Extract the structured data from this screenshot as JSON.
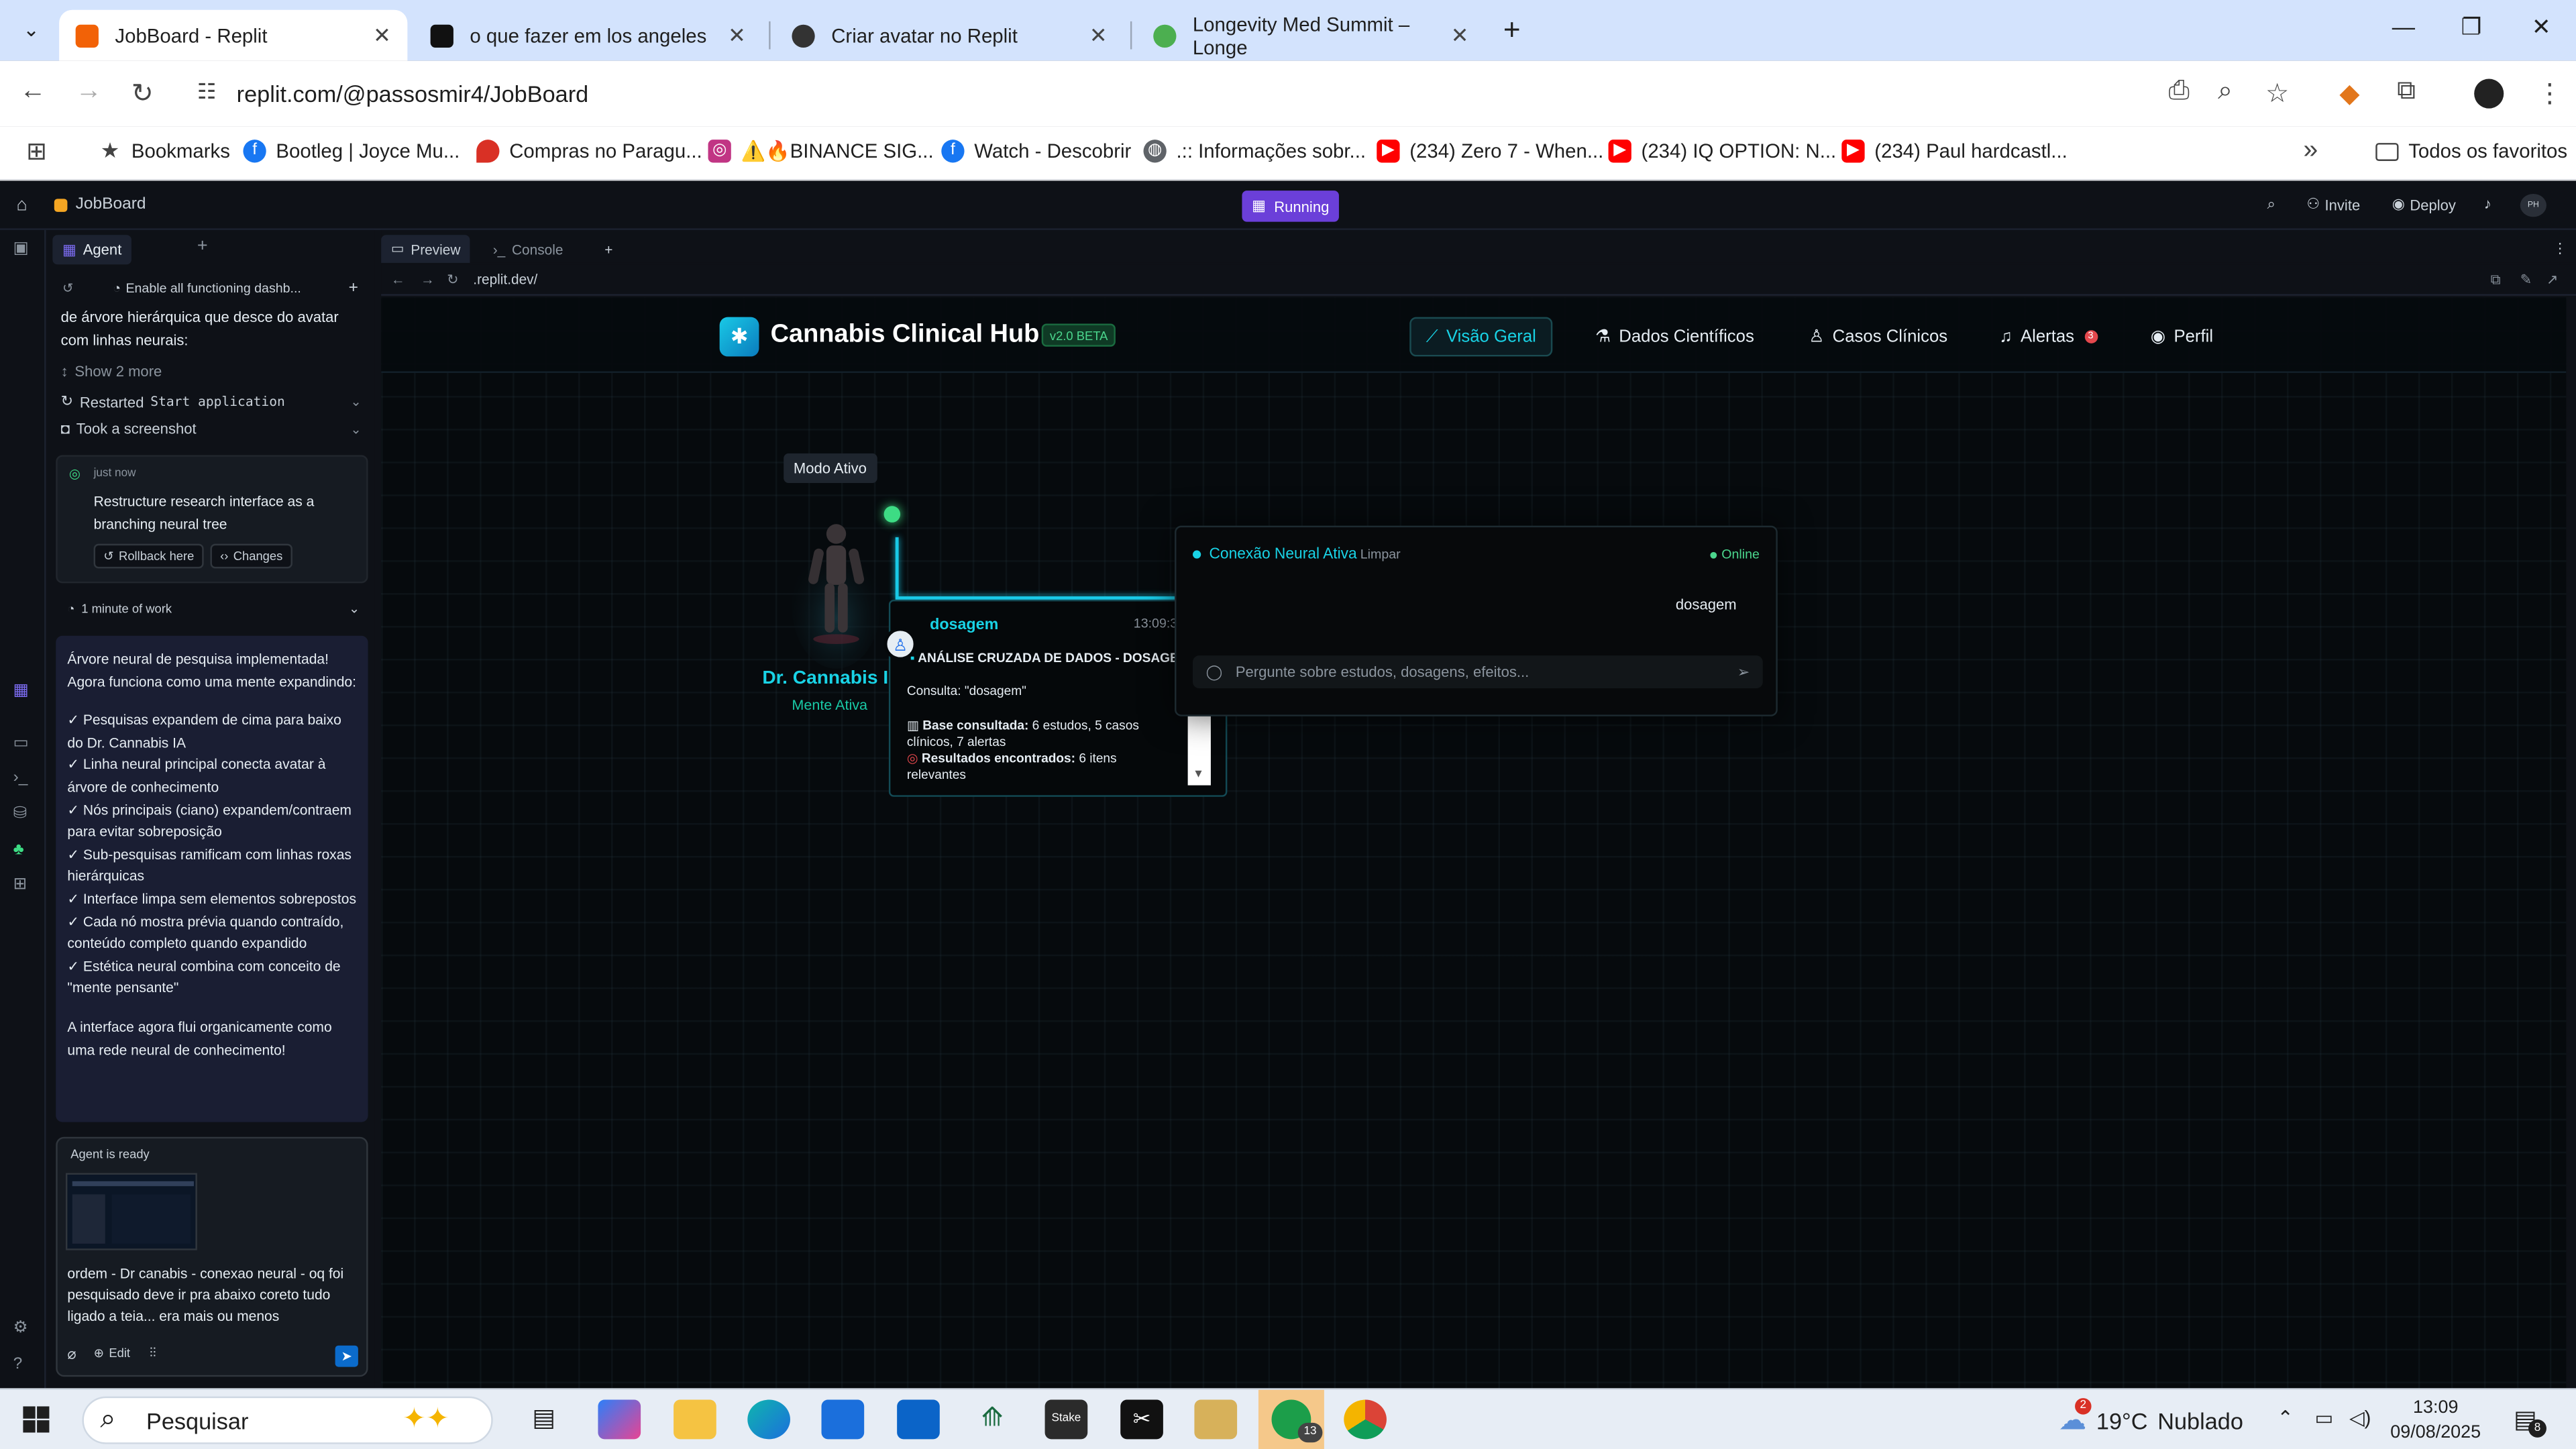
{
  "browser": {
    "tabs": [
      {
        "label": "JobBoard - Replit",
        "fav_color": "#f26207"
      },
      {
        "label": "o que fazer em los angeles",
        "fav_color": "#111111"
      },
      {
        "label": "Criar avatar no Replit",
        "fav_color": "#333333"
      },
      {
        "label": "Longevity Med Summit – Longe",
        "fav_color": "#4caf50"
      }
    ],
    "close_glyph": "✕",
    "new_tab_glyph": "+",
    "url": "replit.com/@passosmir4/JobBoard",
    "bookmarks": [
      {
        "label": "Bookmarks",
        "icon": "star-icon",
        "color": "#444444"
      },
      {
        "label": "Bootleg | Joyce Mu...",
        "icon": "facebook-icon",
        "color": "#1877f2"
      },
      {
        "label": "Compras no Paragu...",
        "icon": "pin-icon",
        "color": "#d93025"
      },
      {
        "label": "⚠️🔥BINANCE SIG...",
        "icon": "instagram-icon",
        "color": "#c13584"
      },
      {
        "label": "Watch - Descobrir",
        "icon": "facebook-icon",
        "color": "#1877f2"
      },
      {
        "label": ".:: Informações sobr...",
        "icon": "globe-icon",
        "color": "#5f6368"
      },
      {
        "label": "(234) Zero 7 - When...",
        "icon": "youtube-icon",
        "color": "#ff0000"
      },
      {
        "label": "(234) IQ OPTION: N...",
        "icon": "youtube-icon",
        "color": "#ff0000"
      },
      {
        "label": "(234) Paul hardcastl...",
        "icon": "youtube-icon",
        "color": "#ff0000"
      }
    ],
    "all_bookmarks": "Todos os favoritos"
  },
  "replit": {
    "project": "JobBoard",
    "status": "Running",
    "invite": "Invite",
    "deploy": "Deploy",
    "avatar_initials": "PH",
    "agent_tab": "Agent",
    "agent_task": "Enable all functioning dashb...",
    "agent_intro": "de árvore hierárquica que desce do avatar com linhas neurais:",
    "show_more": "Show 2 more",
    "restarted_label": "Restarted",
    "restarted_cmd": "Start application",
    "screenshot_label": "Took a screenshot",
    "checkpoint": {
      "time": "just now",
      "message": "Restructure research interface as a branching neural tree",
      "rollback": "Rollback here",
      "changes": "Changes"
    },
    "work_time": "1 minute of work",
    "summary": [
      "Árvore neural de pesquisa implementada! Agora funciona como uma mente expandindo:",
      "✓ Pesquisas expandem de cima para baixo do Dr. Cannabis IA",
      "✓ Linha neural principal conecta avatar à árvore de conhecimento",
      "✓ Nós principais (ciano) expandem/contraem para evitar sobreposição",
      "✓ Sub-pesquisas ramificam com linhas roxas hierárquicas",
      "✓ Interface limpa sem elementos sobrepostos",
      "✓ Cada nó mostra prévia quando contraído, conteúdo completo quando expandido",
      "✓ Estética neural combina com conceito de \"mente pensante\"",
      "A interface agora flui organicamente como uma rede neural de conhecimento!"
    ],
    "input": {
      "status": "Agent is ready",
      "text": "ordem - Dr canabis - conexao neural - oq foi pesquisado deve ir pra abaixo coreto tudo ligado a teia... era mais ou menos",
      "edit": "Edit"
    },
    "preview_tab": "Preview",
    "console_tab": "Console",
    "preview_url": ".replit.dev/"
  },
  "app": {
    "brand": "Cannabis Clinical Hub",
    "version": "v2.0 BETA",
    "nav": [
      {
        "label": "Visão Geral",
        "icon": "chart-icon",
        "active": true
      },
      {
        "label": "Dados Científicos",
        "icon": "flask-icon",
        "active": false
      },
      {
        "label": "Casos Clínicos",
        "icon": "user-icon",
        "active": false
      },
      {
        "label": "Alertas",
        "icon": "bell-icon",
        "active": false,
        "badge": "3"
      },
      {
        "label": "Perfil",
        "icon": "profile-icon",
        "active": false
      }
    ],
    "mode_label": "Modo Ativo",
    "avatar_name": "Dr. Cannabis IA",
    "avatar_status": "Mente Ativa",
    "node": {
      "title": "dosagem",
      "time": "13:09:3",
      "heading": "ANÁLISE CRUZADA DE DADOS - DOSAGE",
      "query": "Consulta: \"dosagem\"",
      "base_label": "Base consultada:",
      "base_value": "6 estudos, 5 casos",
      "base_value_2": "clínicos, 7 alertas",
      "results_label": "Resultados encontrados:",
      "results_value": "6 itens",
      "results_value_2": "relevantes"
    },
    "chat": {
      "title": "Conexão Neural Ativa",
      "clear": "Limpar",
      "status": "Online",
      "message": "dosagem",
      "placeholder": "Pergunte sobre estudos, dosagens, efeitos..."
    }
  },
  "taskbar": {
    "search": "Pesquisar",
    "weather_temp": "19°C",
    "weather_desc": "Nublado",
    "weather_badge": "2",
    "time": "13:09",
    "date": "09/08/2025",
    "whatsapp_badge": "13",
    "notif_badge": "8"
  },
  "colors": {
    "accent_cyan": "#19d3e6",
    "running_purple": "#6b3fd9",
    "online_green": "#3ddc84"
  }
}
